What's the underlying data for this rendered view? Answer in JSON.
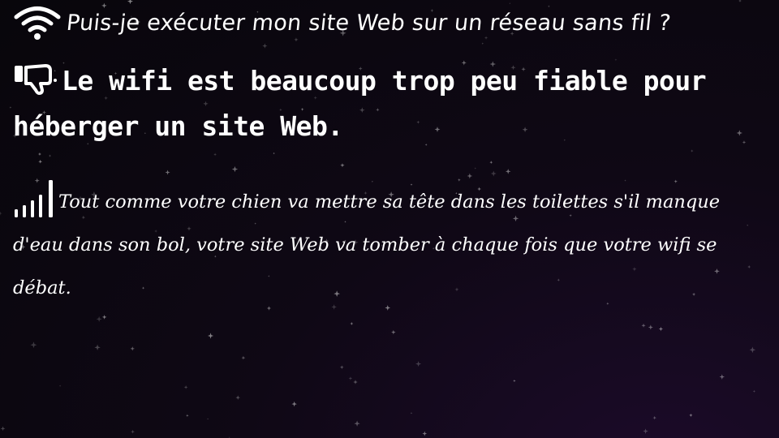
{
  "question": {
    "icon": "wifi-icon",
    "text": "Puis-je exécuter mon site Web sur un réseau sans fil ?"
  },
  "answer": {
    "icon": "thumbs-down-icon",
    "text": "Le wifi est beaucoup trop peu fiable pour héberger un site Web."
  },
  "explanation": {
    "icon": "signal-bars-icon",
    "text": "Tout comme votre chien va mettre sa tête dans les toilettes s'il manque d'eau dans son bol, votre site Web va tomber à chaque fois que votre wifi se débat."
  },
  "colors": {
    "text": "#ffffff",
    "background_dark": "#08060b",
    "background_purple": "#1c0b2a"
  }
}
